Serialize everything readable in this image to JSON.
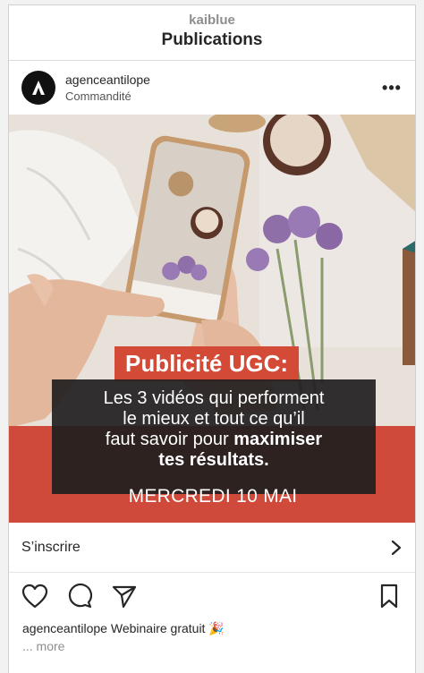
{
  "header": {
    "account": "kaiblue",
    "title": "Publications"
  },
  "post": {
    "author": "agenceantilope",
    "sponsored_label": "Commandité",
    "options_icon": "more-dots-icon",
    "creative": {
      "tag": "Publicité UGC:",
      "line1": "Les 3 vidéos qui performent",
      "line2": "le mieux et tout ce qu’il",
      "line3_prefix": "faut savoir pour ",
      "line3_bold": "maximiser",
      "line4": "tes résultats.",
      "date": "MERCREDI 10 MAI"
    },
    "cta_label": "S’inscrire",
    "caption_user": "agenceantilope",
    "caption_text": "Webinaire gratuit 🎉",
    "more_label": "... more"
  },
  "colors": {
    "accent_red": "#cf4a3a",
    "dark_box": "#211e1f",
    "text": "#262626",
    "muted": "#8e8e8e"
  }
}
